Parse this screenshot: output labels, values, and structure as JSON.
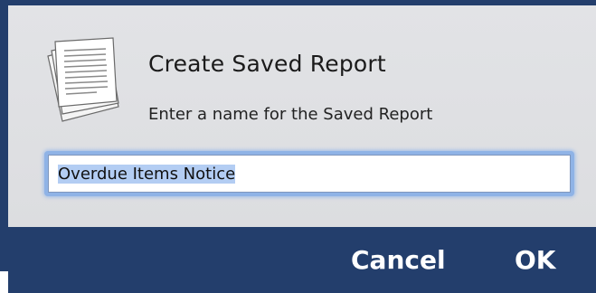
{
  "dialog": {
    "icon": "document-icon",
    "title": "Create Saved Report",
    "prompt": "Enter a name for the Saved Report",
    "name_input": {
      "value": "Overdue Items Notice",
      "selected": true
    },
    "buttons": {
      "cancel_label": "Cancel",
      "ok_label": "OK"
    }
  },
  "colors": {
    "footer_bar": "#233e6c",
    "dialog_background": "#dfe0e3",
    "input_focus_ring": "#8fb3e6",
    "text_selection": "#b3cdf3"
  }
}
